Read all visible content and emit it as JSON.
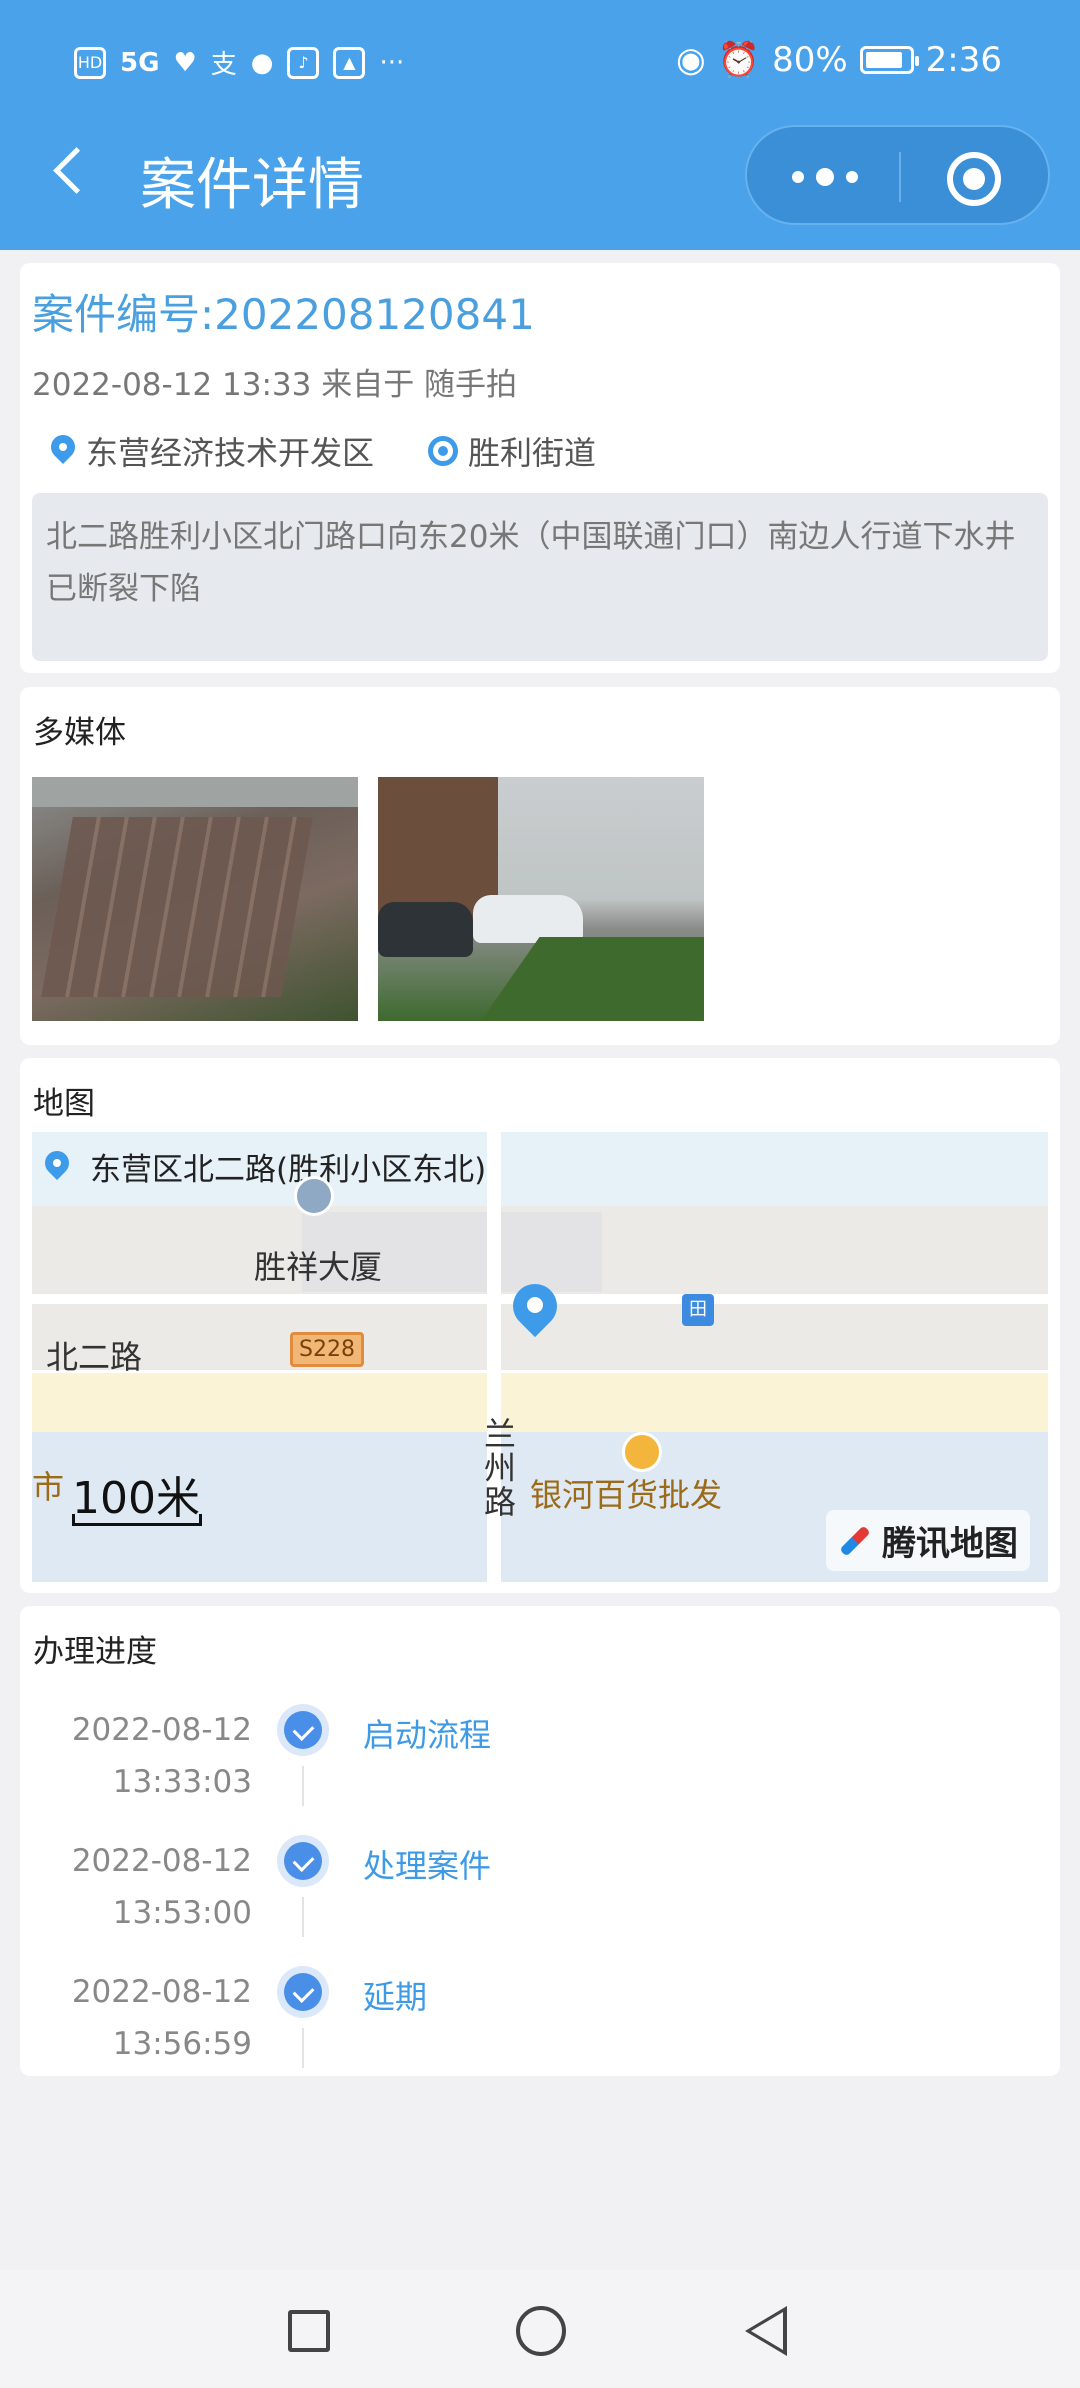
{
  "status_bar": {
    "left_icons": [
      "hd-icon",
      "5g-signal-icon",
      "health-icon",
      "alipay-icon",
      "qq-icon",
      "music-icon",
      "gallery-icon",
      "more-icon"
    ],
    "hd": "HD",
    "signal": "5G",
    "more": "···",
    "battery": "80%",
    "time": "2:36"
  },
  "header": {
    "title": "案件详情"
  },
  "case": {
    "number_label": "案件编号:202208120841",
    "meta": "2022-08-12 13:33 来自于 随手拍",
    "district": "东营经济技术开发区",
    "street": "胜利街道",
    "description": "北二路胜利小区北门路口向东20米（中国联通门口）南边人行道下水井已断裂下陷"
  },
  "media": {
    "title": "多媒体",
    "photos": [
      "photo-manhole",
      "photo-street"
    ]
  },
  "map": {
    "title": "地图",
    "address": "东营区北二路(胜利小区东北)",
    "labels": {
      "building": "胜祥大厦",
      "road": "北二路",
      "route": "S228",
      "side_road": "兰州路",
      "shop": "银河百货批发",
      "edge": "市",
      "scale": "100米",
      "brand": "腾讯地图",
      "bus": "田"
    }
  },
  "progress": {
    "title": "办理进度",
    "steps": [
      {
        "date": "2022-08-12",
        "time": "13:33:03",
        "label": "启动流程"
      },
      {
        "date": "2022-08-12",
        "time": "13:53:00",
        "label": "处理案件"
      },
      {
        "date": "2022-08-12",
        "time": "13:56:59",
        "label": "延期"
      }
    ]
  },
  "colors": {
    "primary": "#4aa3ea",
    "link": "#3f9ae6",
    "background": "#f1f1f3"
  }
}
